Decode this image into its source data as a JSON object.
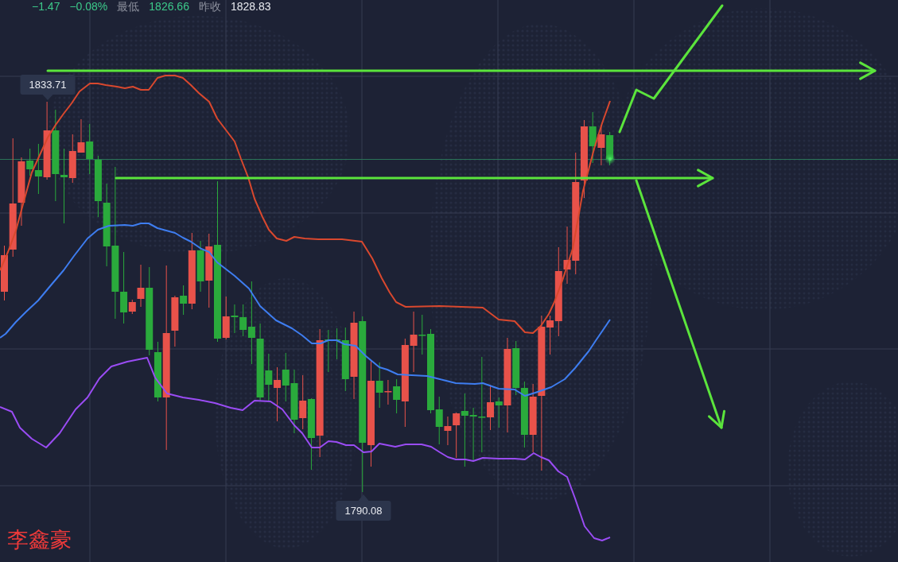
{
  "quote_bar": {
    "change": "−1.47",
    "change_percent": "−0.08%",
    "low": {
      "label": "最低",
      "value": "1826.66"
    },
    "prev_close": {
      "label": "昨收",
      "value": "1828.83"
    }
  },
  "chart": {
    "high_marker": "1833.71",
    "low_marker": "1790.08"
  },
  "signature": "李鑫豪"
}
